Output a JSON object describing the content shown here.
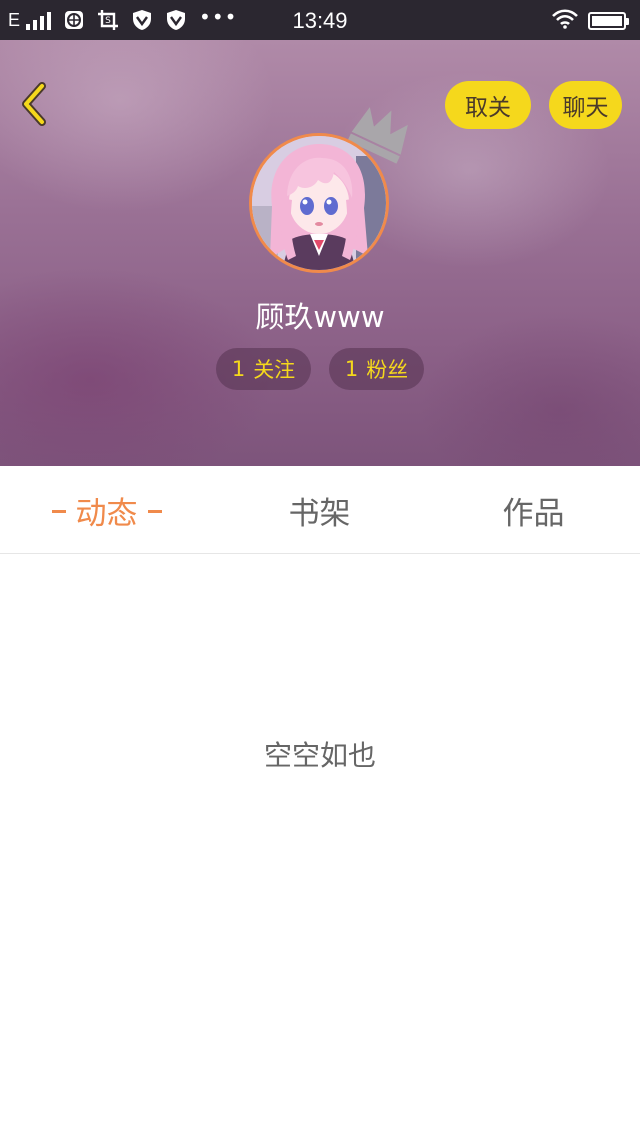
{
  "status_bar": {
    "network": "E",
    "time": "13:49",
    "dots": "•••",
    "battery_level": 1.0,
    "icons": [
      "signal-icon",
      "globe-icon",
      "screenshot-icon",
      "vpn-shield-icon",
      "vpn-shield-icon",
      "wifi-icon",
      "battery-icon"
    ]
  },
  "header": {
    "back_icon": "chevron-left-icon",
    "unfollow_label": "取关",
    "chat_label": "聊天",
    "username": "顾玖www",
    "follow_count": "1",
    "follow_label": "关注",
    "fans_count": "1",
    "fans_label": "粉丝"
  },
  "tabs": [
    {
      "label": "动态",
      "active": true
    },
    {
      "label": "书架",
      "active": false
    },
    {
      "label": "作品",
      "active": false
    }
  ],
  "empty_text": "空空如也",
  "colors": {
    "accent_yellow": "#f5d81c",
    "accent_orange": "#f08a4b",
    "status_bar_bg": "#2b2730",
    "header_bg": "#9a7195"
  }
}
